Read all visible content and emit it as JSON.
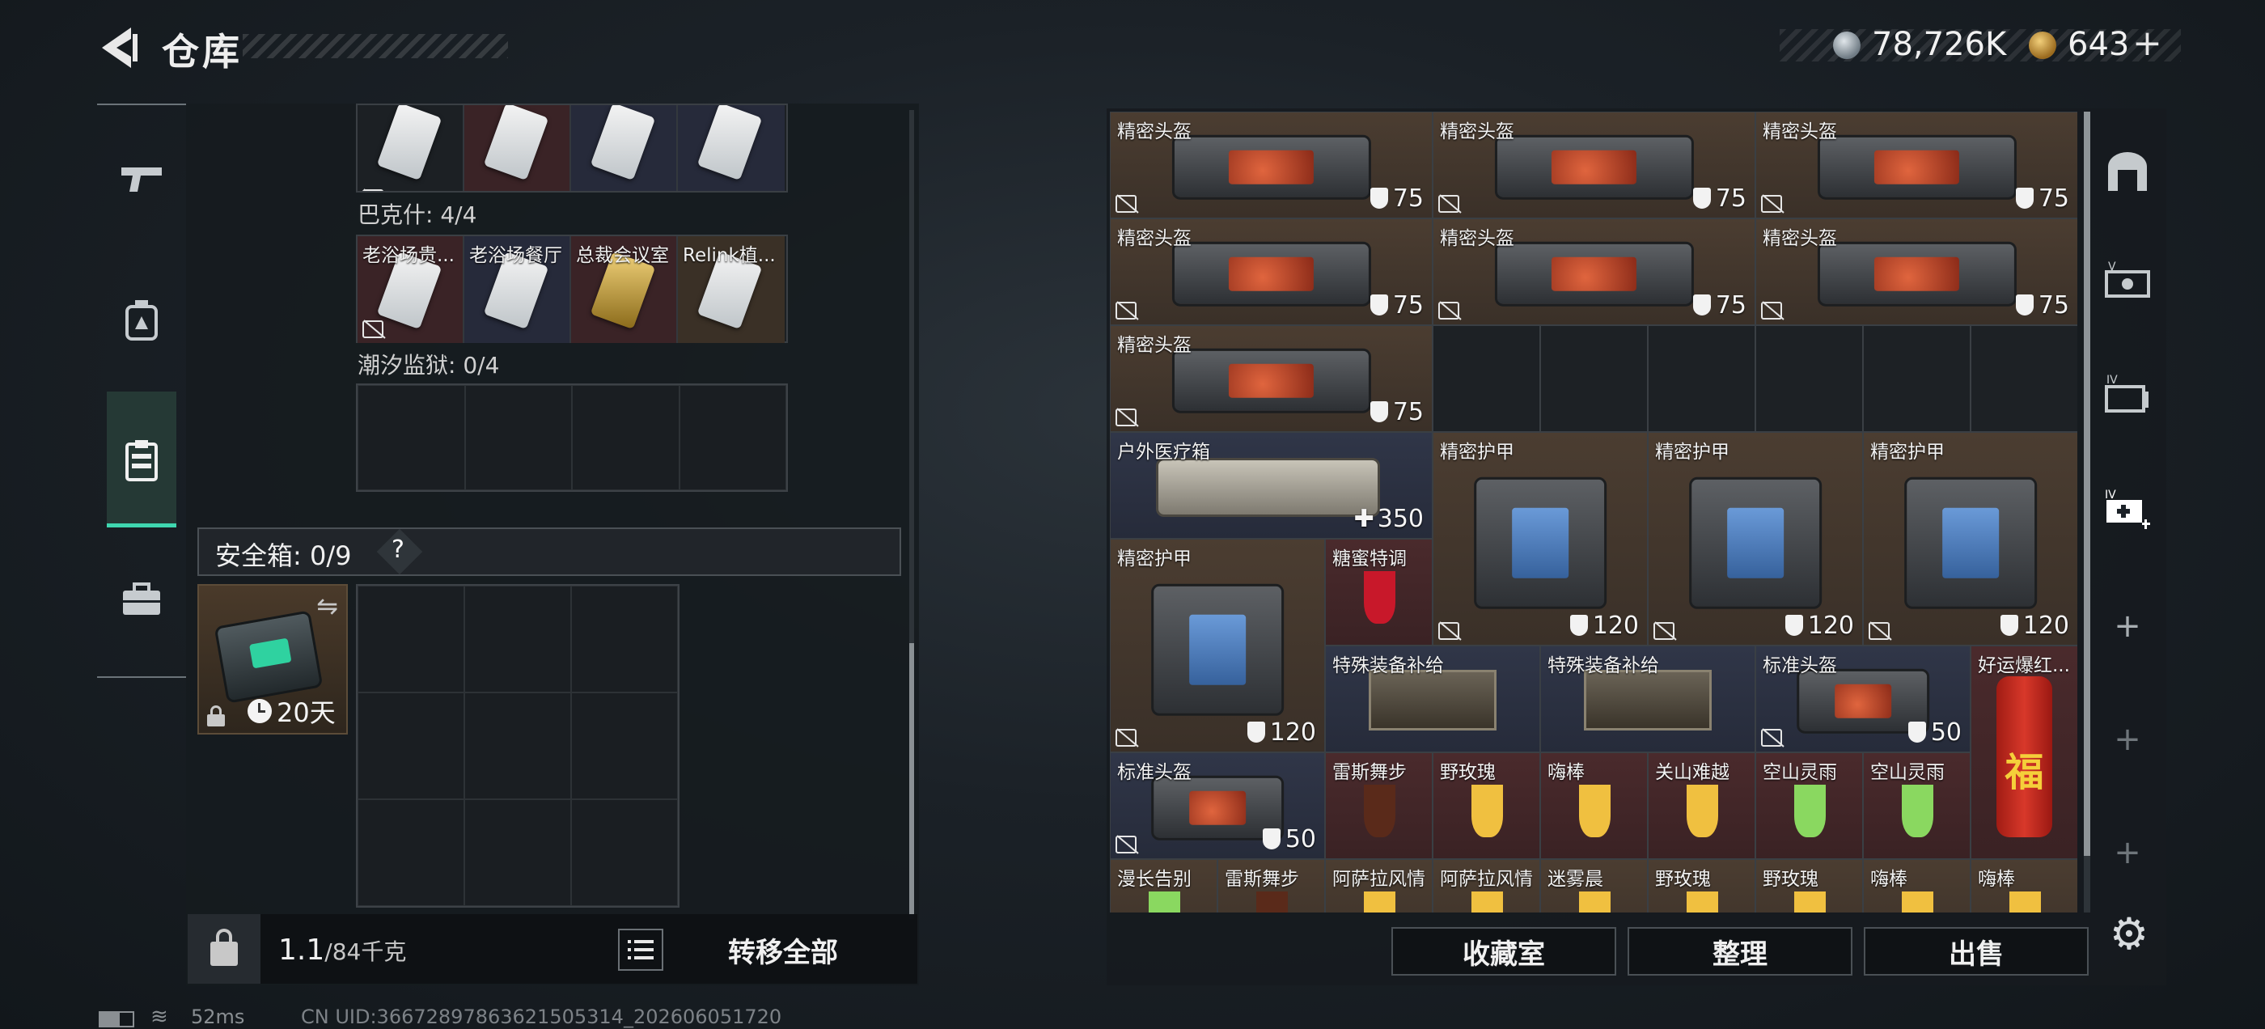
{
  "header": {
    "title": "仓库",
    "currency1_value": "78,726K",
    "currency2_value": "643",
    "currency2_plus": "+"
  },
  "left_rail": {
    "items": [
      {
        "name": "weapon-icon",
        "active": false
      },
      {
        "name": "gear-bag-icon",
        "active": false
      },
      {
        "name": "clipboard-icon",
        "active": true
      },
      {
        "name": "briefcase-icon",
        "active": false
      }
    ]
  },
  "keys": {
    "top_row": [
      "",
      "",
      "",
      ""
    ],
    "bakesh_label": "巴克什: 4/4",
    "bakesh_row": [
      "老浴场贵...",
      "老浴场餐厅",
      "总裁会议室",
      "Relink植..."
    ],
    "chaoxi_label": "潮汐监狱: 0/4"
  },
  "safebox": {
    "label": "安全箱: 0/9",
    "help": "?",
    "item_time": "20天"
  },
  "capacity": {
    "current": "1.1",
    "max": "/84千克"
  },
  "buttons": {
    "transfer_all": "转移全部",
    "collection": "收藏室",
    "organize": "整理",
    "sell": "出售"
  },
  "inventory": [
    {
      "name": "精密头盔",
      "value": "75",
      "kind": "shield"
    },
    {
      "name": "精密头盔",
      "value": "75",
      "kind": "shield"
    },
    {
      "name": "精密头盔",
      "value": "75",
      "kind": "shield"
    },
    {
      "name": "精密头盔",
      "value": "75",
      "kind": "shield"
    },
    {
      "name": "精密头盔",
      "value": "75",
      "kind": "shield"
    },
    {
      "name": "精密头盔",
      "value": "75",
      "kind": "shield"
    },
    {
      "name": "精密头盔",
      "value": "75",
      "kind": "shield"
    },
    {
      "name": "户外医疗箱",
      "value": "350",
      "kind": "plus"
    },
    {
      "name": "精密护甲",
      "value": "120",
      "kind": "shield"
    },
    {
      "name": "精密护甲",
      "value": "120",
      "kind": "shield"
    },
    {
      "name": "精密护甲",
      "value": "120",
      "kind": "shield"
    },
    {
      "name": "精密护甲",
      "value": "120",
      "kind": "shield"
    },
    {
      "name": "糖蜜特调",
      "value": "",
      "kind": "none"
    },
    {
      "name": "特殊装备补给",
      "value": "",
      "kind": "none"
    },
    {
      "name": "特殊装备补给",
      "value": "",
      "kind": "none"
    },
    {
      "name": "标准头盔",
      "value": "50",
      "kind": "shield"
    },
    {
      "name": "好运爆红...",
      "value": "",
      "kind": "none"
    },
    {
      "name": "标准头盔",
      "value": "50",
      "kind": "shield"
    },
    {
      "name": "雷斯舞步",
      "value": "",
      "kind": "none"
    },
    {
      "name": "野玫瑰",
      "value": "",
      "kind": "none"
    },
    {
      "name": "嗨棒",
      "value": "",
      "kind": "none"
    },
    {
      "name": "关山难越",
      "value": "",
      "kind": "none"
    },
    {
      "name": "空山灵雨",
      "value": "",
      "kind": "none"
    },
    {
      "name": "空山灵雨",
      "value": "",
      "kind": "none"
    },
    {
      "name": "漫长告别",
      "value": "",
      "kind": "none"
    },
    {
      "name": "雷斯舞步",
      "value": "",
      "kind": "none"
    },
    {
      "name": "阿萨拉风情",
      "value": "",
      "kind": "none"
    },
    {
      "name": "阿萨拉风情",
      "value": "",
      "kind": "none"
    },
    {
      "name": "迷雾晨",
      "value": "",
      "kind": "none"
    },
    {
      "name": "野玫瑰",
      "value": "",
      "kind": "none"
    },
    {
      "name": "野玫瑰",
      "value": "",
      "kind": "none"
    },
    {
      "name": "嗨棒",
      "value": "",
      "kind": "none"
    },
    {
      "name": "嗨棒",
      "value": "",
      "kind": "none"
    }
  ],
  "firecracker_char": "福",
  "status": {
    "ping": "52ms",
    "uid": "CN UID:36672897863621505314_202606051720"
  },
  "colors": {
    "accent": "#3fd7b0",
    "panel": "#161b1f"
  }
}
